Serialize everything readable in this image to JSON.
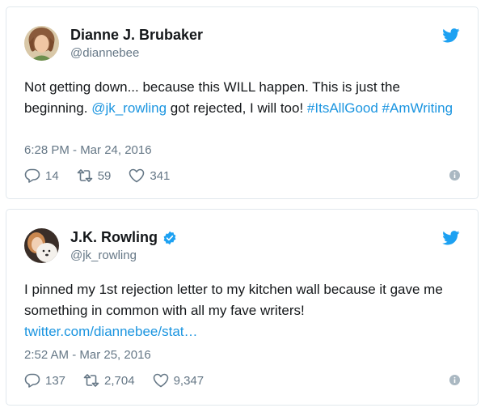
{
  "tweets": [
    {
      "name": "Dianne J. Brubaker",
      "handle": "@diannebee",
      "verified": false,
      "text_segments": [
        {
          "text": "Not getting down... because this WILL happen. This is just the beginning. ",
          "link": false
        },
        {
          "text": "@jk_rowling",
          "link": true
        },
        {
          "text": " got rejected, I will too! ",
          "link": false
        },
        {
          "text": "#ItsAllGood",
          "link": true
        },
        {
          "text": " ",
          "link": false
        },
        {
          "text": "#AmWriting",
          "link": true
        }
      ],
      "timestamp": "6:28 PM - Mar 24, 2016",
      "replies": "14",
      "retweets": "59",
      "likes": "341"
    },
    {
      "name": "J.K. Rowling",
      "handle": "@jk_rowling",
      "verified": true,
      "text_segments": [
        {
          "text": "I pinned my 1st rejection letter to my kitchen wall because it gave me something in common with all my fave writers! ",
          "link": false
        },
        {
          "text": "twitter.com/diannebee/stat…",
          "link": true
        }
      ],
      "timestamp": "2:52 AM - Mar 25, 2016",
      "replies": "137",
      "retweets": "2,704",
      "likes": "9,347"
    }
  ],
  "colors": {
    "link": "#1b95e0",
    "secondary_text": "#657786",
    "border": "#e1e8ed",
    "verified": "#1da1f2"
  },
  "icons": [
    "twitter-bird-icon",
    "verified-badge-icon",
    "reply-icon",
    "retweet-icon",
    "like-icon",
    "info-icon"
  ]
}
